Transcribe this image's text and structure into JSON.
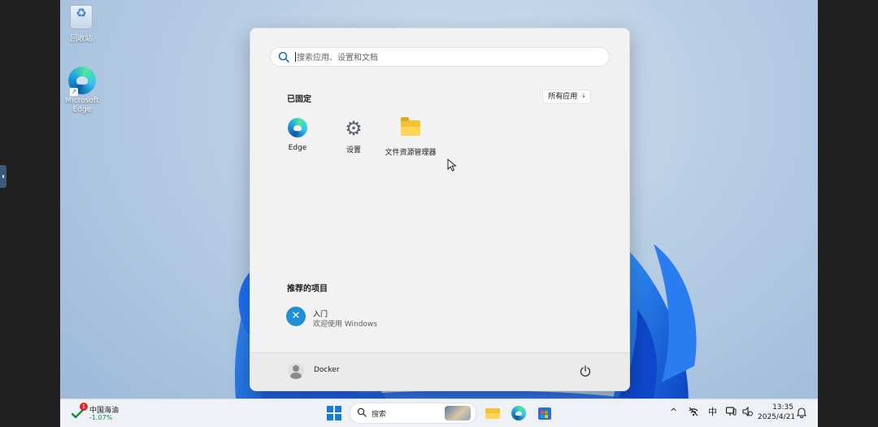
{
  "desktop": {
    "icons": [
      {
        "label": "回收站"
      },
      {
        "label": "Microsoft Edge"
      }
    ]
  },
  "start_menu": {
    "search": {
      "placeholder": "搜索应用、设置和文档"
    },
    "pinned": {
      "title": "已固定",
      "all_apps_label": "所有应用",
      "all_apps_chevron": "›",
      "apps": [
        {
          "label": "Edge",
          "icon": "edge-icon"
        },
        {
          "label": "设置",
          "icon": "gear-icon"
        },
        {
          "label": "文件资源管理器",
          "icon": "folder-icon"
        }
      ]
    },
    "recommended": {
      "title": "推荐的项目",
      "items": [
        {
          "title": "入门",
          "subtitle": "欢迎使用 Windows",
          "icon": "get-started-icon"
        }
      ]
    },
    "footer": {
      "user_name": "Docker"
    }
  },
  "taskbar": {
    "widget": {
      "badge": "1",
      "name": "中国海油",
      "change": "-1.07%",
      "change_color": "#1a8a3a"
    },
    "search_label": "搜索",
    "tray": {
      "chevron": "^",
      "ime": "中"
    },
    "clock": {
      "time": "13:35",
      "date": "2025/4/21"
    }
  },
  "colors": {
    "accent": "#1679e0",
    "badge": "#d62828"
  }
}
